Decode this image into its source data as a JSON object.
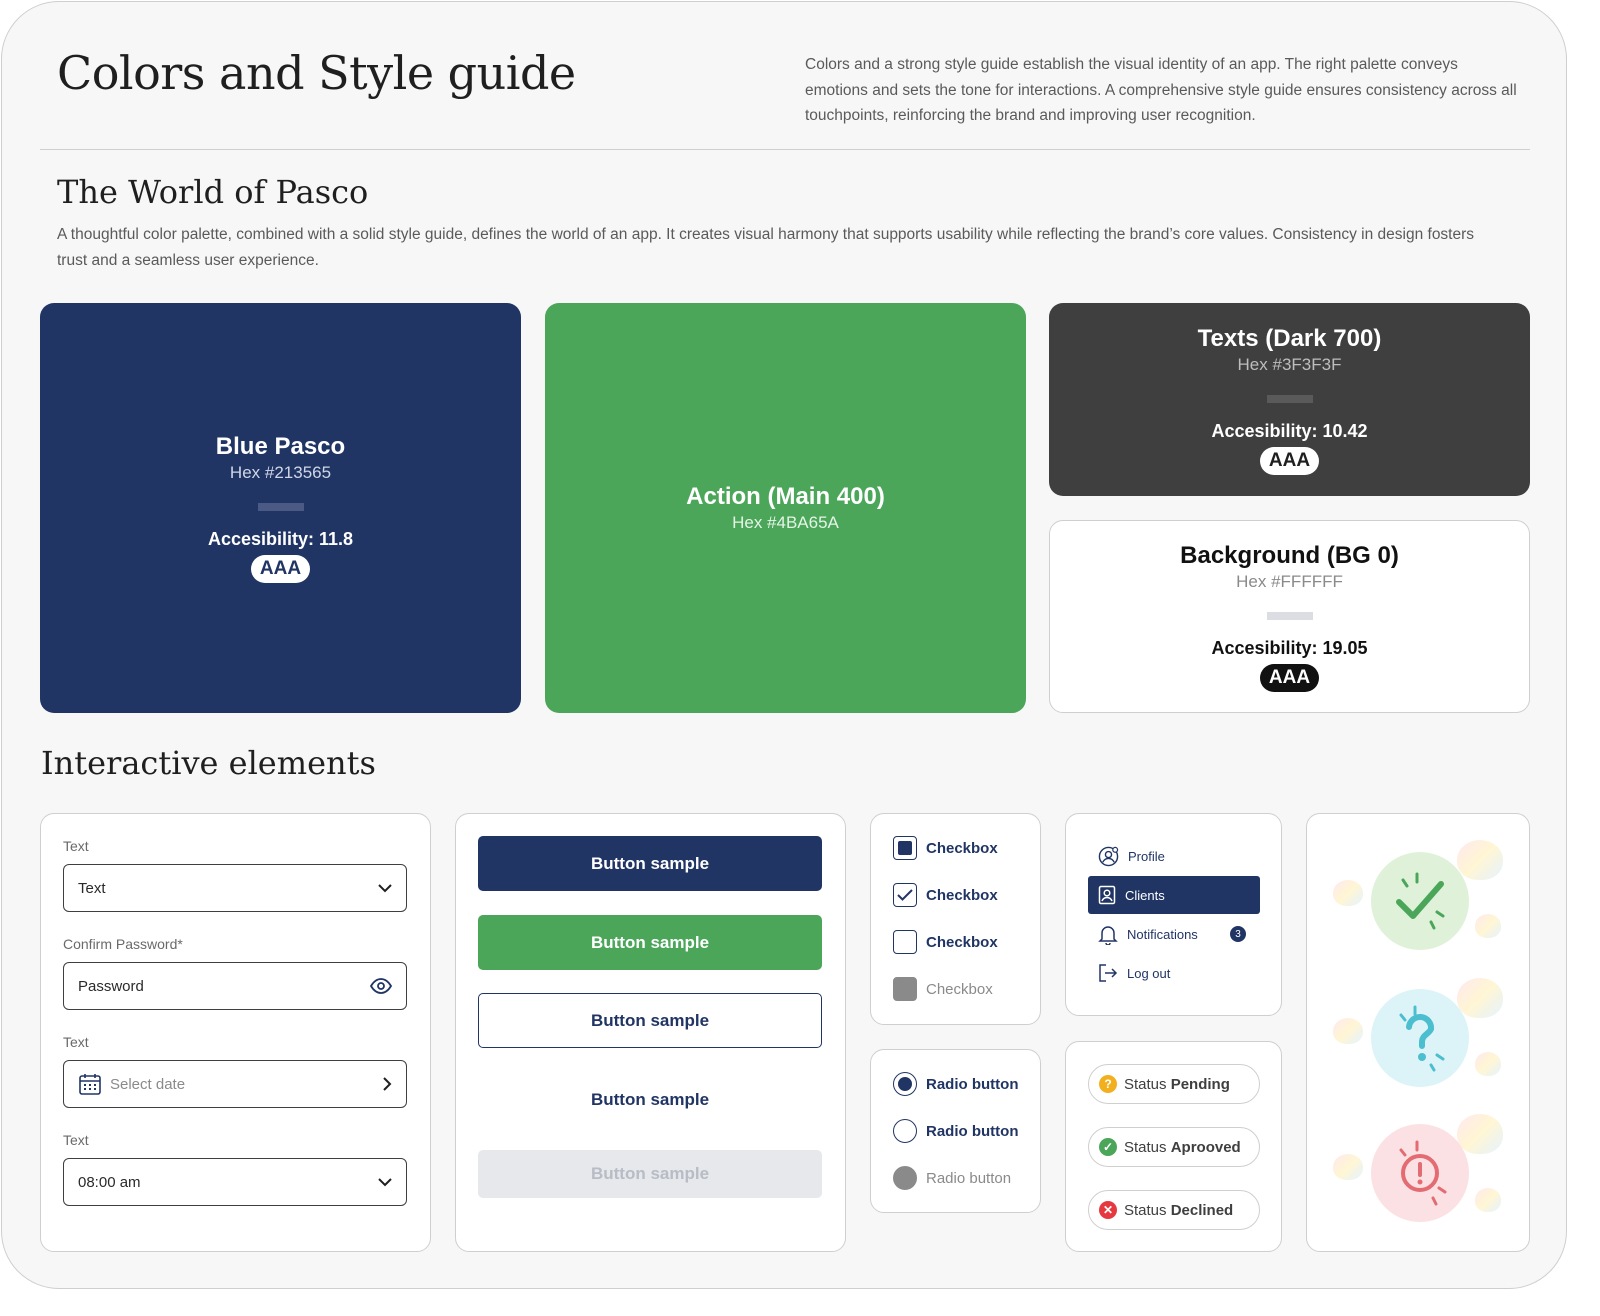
{
  "header": {
    "title": "Colors and Style guide",
    "intro": "Colors and a strong style guide establish the visual identity of an app. The right palette conveys emotions and sets the tone for interactions. A comprehensive style guide ensures consistency across all touchpoints, reinforcing the brand and improving user recognition."
  },
  "world": {
    "title": "The World of Pasco",
    "description": "A thoughtful color palette, combined with a solid style guide, defines the world of an app. It creates visual harmony that supports usability while reflecting the brand’s core values. Consistency in design fosters trust and a seamless user experience."
  },
  "colors": {
    "blue": {
      "name": "Blue Pasco",
      "hex": "Hex #213565",
      "accessibility": "Accesibility: 11.8",
      "badge": "AAA",
      "color": "#213565"
    },
    "action": {
      "name": "Action (Main 400)",
      "hex": "Hex #4BA65A",
      "color": "#4BA65A"
    },
    "texts": {
      "name": "Texts (Dark 700)",
      "hex": "Hex #3F3F3F",
      "accessibility": "Accesibility: 10.42",
      "badge": "AAA",
      "color": "#3F3F3F"
    },
    "background": {
      "name": "Background (BG 0)",
      "hex": "Hex #FFFFFF",
      "accessibility": "Accesibility: 19.05",
      "badge": "AAA",
      "color": "#FFFFFF"
    }
  },
  "interactive": {
    "title": "Interactive elements",
    "form": {
      "label1": "Text",
      "select1_value": "Text",
      "label2": "Confirm Password*",
      "password_value": "Password",
      "label3": "Text",
      "date_placeholder": "Select date",
      "label4": "Text",
      "time_value": "08:00 am"
    },
    "buttons": {
      "primary": "Button sample",
      "action": "Button sample",
      "outline": "Button sample",
      "text": "Button sample",
      "disabled": "Button sample"
    },
    "checkboxes": [
      "Checkbox",
      "Checkbox",
      "Checkbox",
      "Checkbox"
    ],
    "radios": [
      "Radio button",
      "Radio button",
      "Radio button"
    ],
    "menu": {
      "profile": "Profile",
      "clients": "Clients",
      "notifications": "Notifications",
      "notifications_count": "3",
      "logout": "Log out"
    },
    "statuses": {
      "pending_prefix": "Status",
      "pending": "Pending",
      "approved_prefix": "Status",
      "approved": "Aprooved",
      "declined_prefix": "Status",
      "declined": "Declined"
    }
  }
}
